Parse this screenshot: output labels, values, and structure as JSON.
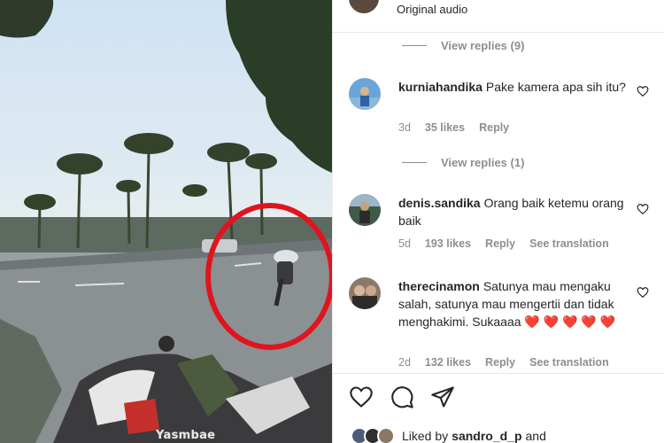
{
  "video": {
    "watermark": "Yasmbae"
  },
  "header": {
    "audio_label": "Original audio"
  },
  "reply_links": [
    {
      "label": "View replies (9)"
    },
    {
      "label": "View replies (1)"
    }
  ],
  "comments": [
    {
      "username": "kurniahandika",
      "text": "Pake kamera apa sih itu?",
      "time": "3d",
      "likes": "35 likes",
      "reply": "Reply"
    },
    {
      "username": "denis.sandika",
      "text": "Orang baik ketemu orang baik",
      "time": "5d",
      "likes": "193 likes",
      "reply": "Reply",
      "translation": "See translation"
    },
    {
      "username": "therecinamon",
      "text": "Satunya mau mengaku salah, satunya mau mengertii dan tidak menghakimi. Sukaaaa",
      "emoji": "❤️ ❤️ ❤️ ❤️ ❤️",
      "time": "2d",
      "likes": "132 likes",
      "reply": "Reply",
      "translation": "See translation"
    }
  ],
  "footer": {
    "liked_by_prefix": "Liked by",
    "liked_by_user": "sandro_d_p",
    "liked_by_suffix": "and"
  },
  "icons": {
    "like": "heart-outline-icon",
    "comment": "speech-bubble-icon",
    "share": "paper-plane-icon"
  },
  "colors": {
    "highlight_circle": "#e0141e",
    "heart_emoji": "#ed4956"
  }
}
